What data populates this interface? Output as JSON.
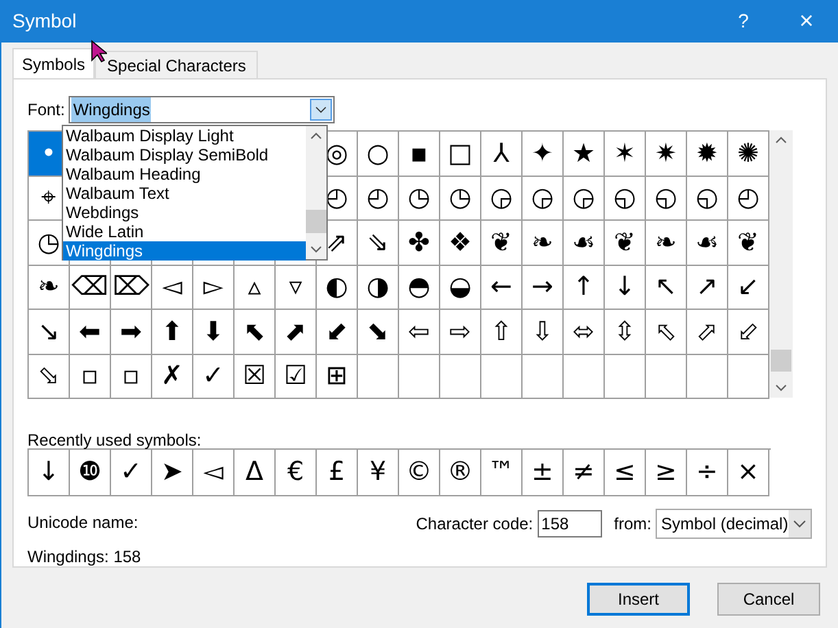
{
  "window": {
    "title": "Symbol",
    "help": "?",
    "close": "×"
  },
  "tabs": [
    {
      "label": "Symbols",
      "selected": true
    },
    {
      "label": "Special Characters",
      "selected": false
    }
  ],
  "font": {
    "label": "Font:",
    "value": "Wingdings",
    "expanded": true,
    "options": [
      {
        "label": "Walbaum Display Light",
        "selected": false
      },
      {
        "label": "Walbaum Display SemiBold",
        "selected": false
      },
      {
        "label": "Walbaum Heading",
        "selected": false
      },
      {
        "label": "Walbaum Text",
        "selected": false
      },
      {
        "label": "Webdings",
        "selected": false
      },
      {
        "label": "Wide Latin",
        "selected": false
      },
      {
        "label": "Wingdings",
        "selected": true
      }
    ]
  },
  "symbol_grid": {
    "rows": [
      {
        "left": [
          {
            "symbol": "•",
            "selected": true
          }
        ],
        "right": [
          {
            "symbol": "◎",
            "selected": false
          },
          {
            "symbol": "○",
            "selected": false
          },
          {
            "symbol": "▪",
            "selected": false
          },
          {
            "symbol": "□",
            "selected": false
          },
          {
            "symbol": "⅄",
            "selected": false
          },
          {
            "symbol": "✦",
            "selected": false
          },
          {
            "symbol": "★",
            "selected": false
          },
          {
            "symbol": "✶",
            "selected": false
          },
          {
            "symbol": "✷",
            "selected": false
          },
          {
            "symbol": "✹",
            "selected": false
          },
          {
            "symbol": "✺",
            "selected": false
          }
        ]
      },
      {
        "left": [
          {
            "symbol": "⌖",
            "selected": false
          }
        ],
        "right": [
          {
            "symbol": "◴",
            "selected": false
          },
          {
            "symbol": "◴",
            "selected": false
          },
          {
            "symbol": "◷",
            "selected": false
          },
          {
            "symbol": "◷",
            "selected": false
          },
          {
            "symbol": "◶",
            "selected": false
          },
          {
            "symbol": "◶",
            "selected": false
          },
          {
            "symbol": "◶",
            "selected": false
          },
          {
            "symbol": "◵",
            "selected": false
          },
          {
            "symbol": "◵",
            "selected": false
          },
          {
            "symbol": "◵",
            "selected": false
          },
          {
            "symbol": "◴",
            "selected": false
          }
        ]
      },
      {
        "left": [
          {
            "symbol": "◷",
            "selected": false
          }
        ],
        "right": [
          {
            "symbol": "⇗",
            "selected": false
          },
          {
            "symbol": "⇘",
            "selected": false
          },
          {
            "symbol": "✤",
            "selected": false
          },
          {
            "symbol": "❖",
            "selected": false
          },
          {
            "symbol": "❦",
            "selected": false
          },
          {
            "symbol": "❧",
            "selected": false
          },
          {
            "symbol": "☙",
            "selected": false
          },
          {
            "symbol": "❦",
            "selected": false
          },
          {
            "symbol": "❧",
            "selected": false
          },
          {
            "symbol": "☙",
            "selected": false
          },
          {
            "symbol": "❦",
            "selected": false
          }
        ]
      },
      {
        "left": [
          {
            "symbol": "❧",
            "selected": false
          },
          {
            "symbol": "⌫",
            "selected": false
          },
          {
            "symbol": "⌦",
            "selected": false
          },
          {
            "symbol": "◅",
            "selected": false
          },
          {
            "symbol": "▻",
            "selected": false
          },
          {
            "symbol": "▵",
            "selected": false
          },
          {
            "symbol": "▿",
            "selected": false
          },
          {
            "symbol": "◐",
            "selected": false
          },
          {
            "symbol": "◑",
            "selected": false
          },
          {
            "symbol": "◓",
            "selected": false
          },
          {
            "symbol": "◒",
            "selected": false
          },
          {
            "symbol": "←",
            "selected": false
          },
          {
            "symbol": "→",
            "selected": false
          },
          {
            "symbol": "↑",
            "selected": false
          },
          {
            "symbol": "↓",
            "selected": false
          },
          {
            "symbol": "↖",
            "selected": false
          },
          {
            "symbol": "↗",
            "selected": false
          },
          {
            "symbol": "↙",
            "selected": false
          }
        ]
      },
      {
        "left": [
          {
            "symbol": "↘",
            "selected": false
          },
          {
            "symbol": "⬅",
            "selected": false
          },
          {
            "symbol": "➡",
            "selected": false
          },
          {
            "symbol": "⬆",
            "selected": false
          },
          {
            "symbol": "⬇",
            "selected": false
          },
          {
            "symbol": "⬉",
            "selected": false
          },
          {
            "symbol": "⬈",
            "selected": false
          },
          {
            "symbol": "⬋",
            "selected": false
          },
          {
            "symbol": "⬊",
            "selected": false
          },
          {
            "symbol": "⇦",
            "selected": false
          },
          {
            "symbol": "⇨",
            "selected": false
          },
          {
            "symbol": "⇧",
            "selected": false
          },
          {
            "symbol": "⇩",
            "selected": false
          },
          {
            "symbol": "⬄",
            "selected": false
          },
          {
            "symbol": "⇳",
            "selected": false
          },
          {
            "symbol": "⬁",
            "selected": false
          },
          {
            "symbol": "⬀",
            "selected": false
          },
          {
            "symbol": "⬃",
            "selected": false
          }
        ]
      },
      {
        "left": [
          {
            "symbol": "⬂",
            "selected": false
          },
          {
            "symbol": "▫",
            "selected": false
          },
          {
            "symbol": "▫",
            "selected": false
          },
          {
            "symbol": "✗",
            "selected": false
          },
          {
            "symbol": "✓",
            "selected": false
          },
          {
            "symbol": "☒",
            "selected": false
          },
          {
            "symbol": "☑",
            "selected": false
          },
          {
            "symbol": "⊞",
            "selected": false
          }
        ]
      }
    ]
  },
  "recent": {
    "label": "Recently used symbols:",
    "symbols": [
      "↓",
      "❿",
      "✓",
      "➤",
      "◅",
      "Δ",
      "€",
      "£",
      "¥",
      "©",
      "®",
      "™",
      "±",
      "≠",
      "≤",
      "≥",
      "÷",
      "×"
    ]
  },
  "unicode_name": {
    "label": "Unicode name:",
    "value": "Wingdings: 158"
  },
  "character_code": {
    "label": "Character code:",
    "value": "158"
  },
  "from": {
    "label": "from:",
    "value": "Symbol (decimal)"
  },
  "buttons": [
    {
      "label": "Insert",
      "default": true
    },
    {
      "label": "Cancel",
      "default": false
    }
  ]
}
